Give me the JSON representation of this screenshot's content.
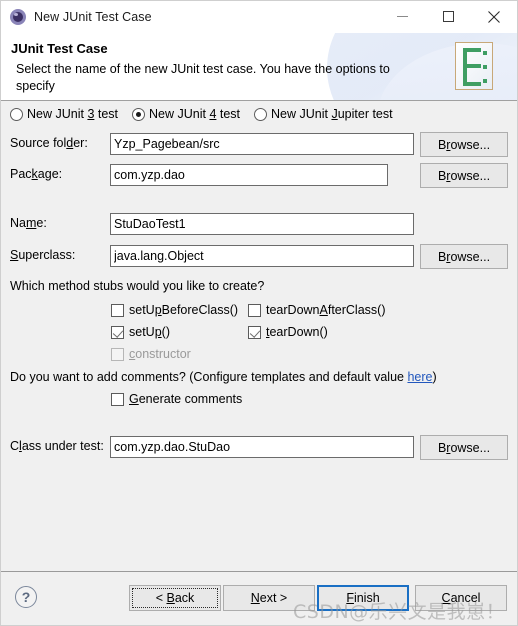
{
  "window": {
    "title": "New JUnit Test Case",
    "app_icon": "eclipse-gear-icon",
    "minimize_label": "Minimize",
    "maximize_label": "Maximize",
    "close_label": "Close"
  },
  "banner": {
    "title": "JUnit Test Case",
    "description": "Select the name of the new JUnit test case. You have the options to specify",
    "icon": "junit-wizard-icon"
  },
  "junit_version": {
    "options": [
      {
        "label_pre": "New JUnit ",
        "mnemonic": "3",
        "label_post": " test",
        "selected": false
      },
      {
        "label_pre": "New JUnit ",
        "mnemonic": "4",
        "label_post": " test",
        "selected": true
      },
      {
        "label_pre": "New JUnit ",
        "mnemonic": "J",
        "label_post": "upiter test",
        "selected": false
      }
    ]
  },
  "fields": {
    "source_folder": {
      "label_pre": "Source fol",
      "mnemonic": "d",
      "label_post": "er:",
      "value": "Yzp_Pagebean/src",
      "browse_pre": "B",
      "browse_mnemonic": "r",
      "browse_post": "owse..."
    },
    "package": {
      "label_pre": "Pac",
      "mnemonic": "k",
      "label_post": "age:",
      "value": "com.yzp.dao",
      "browse_pre": "B",
      "browse_mnemonic": "r",
      "browse_post": "owse..."
    },
    "name": {
      "label_pre": "Na",
      "mnemonic": "m",
      "label_post": "e:",
      "value": "StuDaoTest1"
    },
    "superclass": {
      "label_pre": "",
      "mnemonic": "S",
      "label_post": "uperclass:",
      "value": "java.lang.Object",
      "browse_pre": "B",
      "browse_mnemonic": "r",
      "browse_post": "owse..."
    },
    "class_under_test": {
      "label_pre": "C",
      "mnemonic": "l",
      "label_post": "ass under test:",
      "value": "com.yzp.dao.StuDao",
      "browse_pre": "B",
      "browse_mnemonic": "r",
      "browse_post": "owse..."
    }
  },
  "method_stubs": {
    "question": "Which method stubs would you like to create?",
    "items": [
      {
        "label_pre": "setU",
        "mnemonic": "p",
        "label_post": "BeforeClass()",
        "checked": false,
        "disabled": false
      },
      {
        "label_pre": "tearDown",
        "mnemonic": "A",
        "label_post": "fterClass()",
        "checked": false,
        "disabled": false
      },
      {
        "label_pre": "setU",
        "mnemonic": "p",
        "label_post": "()",
        "checked": true,
        "disabled": false
      },
      {
        "label_pre": "",
        "mnemonic": "t",
        "label_post": "earDown()",
        "checked": true,
        "disabled": false
      },
      {
        "label_pre": "",
        "mnemonic": "c",
        "label_post": "onstructor",
        "checked": false,
        "disabled": true
      }
    ]
  },
  "comments": {
    "question_pre": "Do you want to add comments? (Configure templates and default value ",
    "link": "here",
    "question_post": ")",
    "checkbox": {
      "label_pre": "",
      "mnemonic": "G",
      "label_post": "enerate comments",
      "checked": false
    }
  },
  "footer": {
    "help_glyph": "?",
    "back_pre": "< ",
    "back_mnemonic": "B",
    "back_post": "ack",
    "next_pre": "",
    "next_mnemonic": "N",
    "next_post": "ext >",
    "finish_pre": "",
    "finish_mnemonic": "F",
    "finish_post": "inish",
    "cancel_pre": "",
    "cancel_mnemonic": "C",
    "cancel_post": "ancel"
  },
  "watermark": {
    "text": "CSDN@乐兴文是我崽！"
  },
  "colors": {
    "dialog_bg": "#f0f0f0",
    "field_bg": "#ffffff",
    "field_border": "#6b6b6b",
    "button_bg": "#e8e8e8",
    "focus_blue": "#1a6fc4",
    "link_blue": "#2257bd",
    "icon_green": "#3f9e63",
    "disabled_text": "#9a9a9a"
  }
}
